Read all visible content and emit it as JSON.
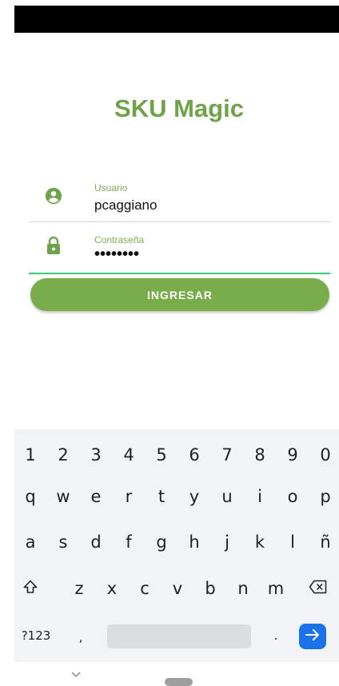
{
  "app": {
    "title": "SKU Magic"
  },
  "form": {
    "user": {
      "label": "Usuario",
      "value": "pcaggiano",
      "icon": "account-circle-icon"
    },
    "password": {
      "label": "Contraseña",
      "value": "••••••••",
      "icon": "lock-icon"
    },
    "submit_label": "INGRESAR"
  },
  "keyboard": {
    "row1": [
      "1",
      "2",
      "3",
      "4",
      "5",
      "6",
      "7",
      "8",
      "9",
      "0"
    ],
    "row2": [
      "q",
      "w",
      "e",
      "r",
      "t",
      "y",
      "u",
      "i",
      "o",
      "p"
    ],
    "row3": [
      "a",
      "s",
      "d",
      "f",
      "g",
      "h",
      "j",
      "k",
      "l",
      "ñ"
    ],
    "row4": [
      "z",
      "x",
      "c",
      "v",
      "b",
      "n",
      "m"
    ],
    "symbols_label": "?123",
    "comma": ",",
    "period": "."
  },
  "colors": {
    "accent": "#78ad4a",
    "title": "#6fa34a",
    "focus_line": "#3cc97a",
    "enter": "#1a73e8"
  }
}
